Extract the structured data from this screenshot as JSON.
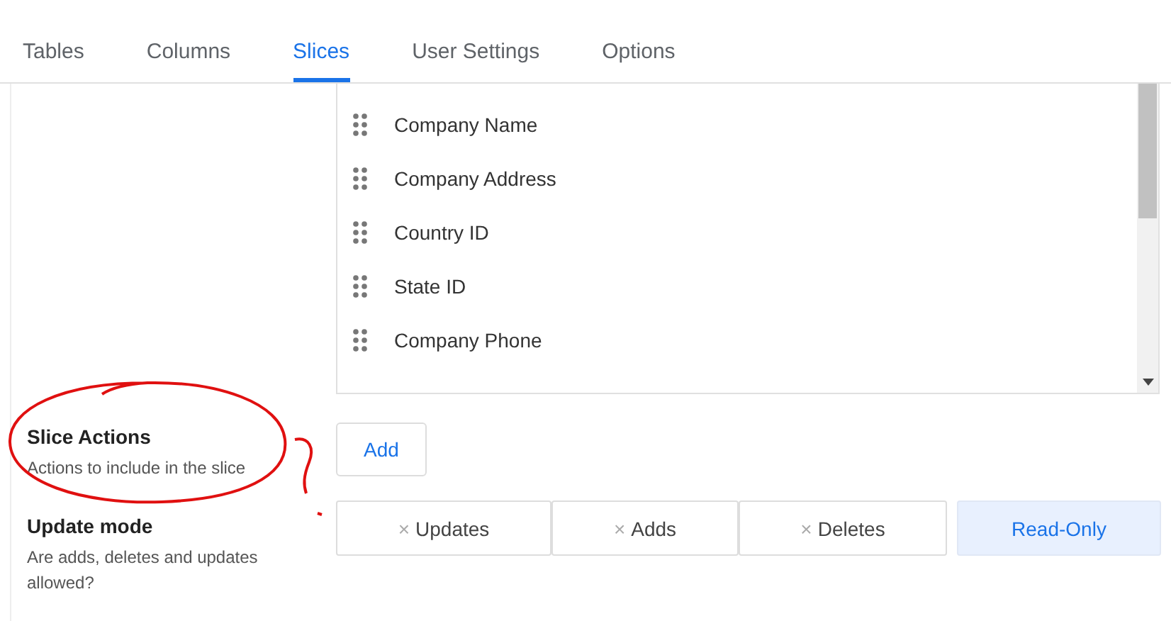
{
  "tabs": [
    {
      "label": "Tables",
      "selected": false
    },
    {
      "label": "Columns",
      "selected": false
    },
    {
      "label": "Slices",
      "selected": true
    },
    {
      "label": "User Settings",
      "selected": false
    },
    {
      "label": "Options",
      "selected": false
    }
  ],
  "column_list": {
    "items": [
      "Company Name",
      "Company Address",
      "Country ID",
      "State ID",
      "Company Phone"
    ]
  },
  "slice_actions": {
    "title": "Slice Actions",
    "description": "Actions to include in the slice",
    "button": "Add"
  },
  "update_mode": {
    "title": "Update mode",
    "description": "Are adds, deletes and updates allowed?",
    "options": [
      {
        "label": "Updates",
        "mark": "×",
        "selected": false
      },
      {
        "label": "Adds",
        "mark": "×",
        "selected": false
      },
      {
        "label": "Deletes",
        "mark": "×",
        "selected": false
      },
      {
        "label": "Read-Only",
        "selected": true
      }
    ]
  }
}
